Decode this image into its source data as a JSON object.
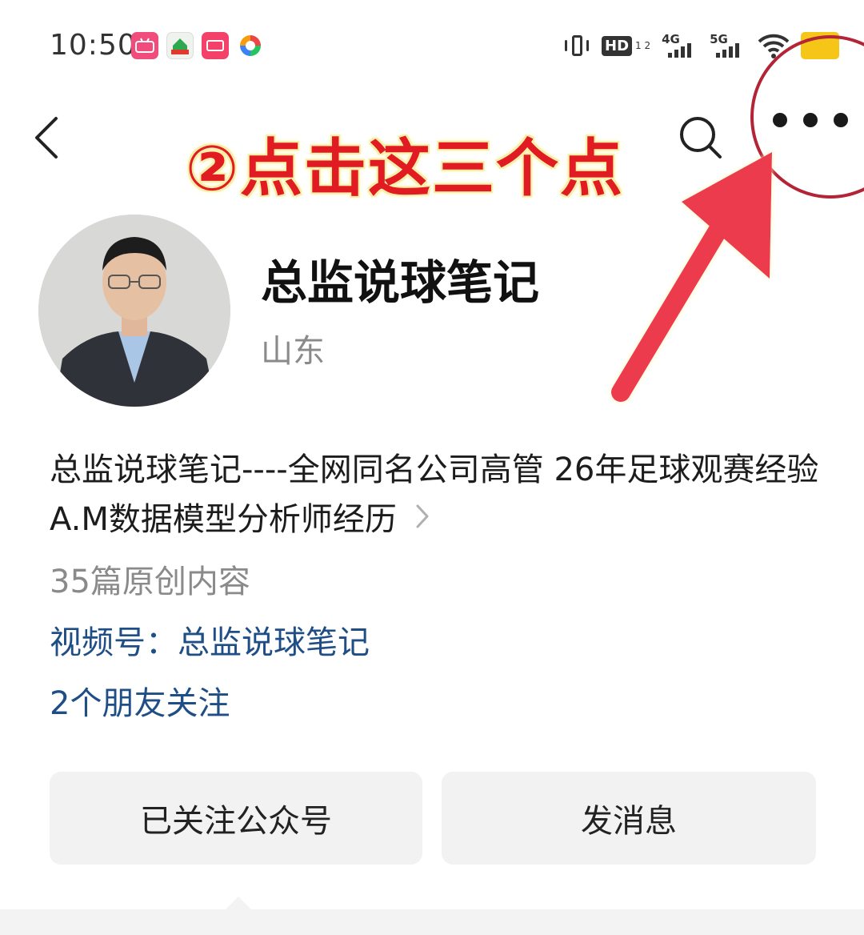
{
  "status_bar": {
    "time": "10:50",
    "apps": [
      "bilibili",
      "home-app",
      "xiaohongshu",
      "colorful-app"
    ],
    "hd_label": "HD",
    "hd_sub": "1 2",
    "sim1": "4G",
    "sim2": "5G"
  },
  "header": {
    "back": "back-icon",
    "search": "search-icon",
    "more": "more-icon"
  },
  "annotation": {
    "text": "②点击这三个点",
    "color": "#e01b22",
    "circle_color": "#b32436"
  },
  "profile": {
    "name": "总监说球笔记",
    "location": "山东",
    "bio": "总监说球笔记----全网同名公司高管 26年足球观赛经验 A.M数据模型分析师经历",
    "original_count": "35篇原创内容",
    "channel": "视频号：总监说球笔记",
    "friends": "2个朋友关注"
  },
  "actions": {
    "follow": "已关注公众号",
    "message": "发消息"
  },
  "colors": {
    "link": "#1f4e86",
    "secondary": "#8a8a8a",
    "button_bg": "#f2f2f2"
  }
}
